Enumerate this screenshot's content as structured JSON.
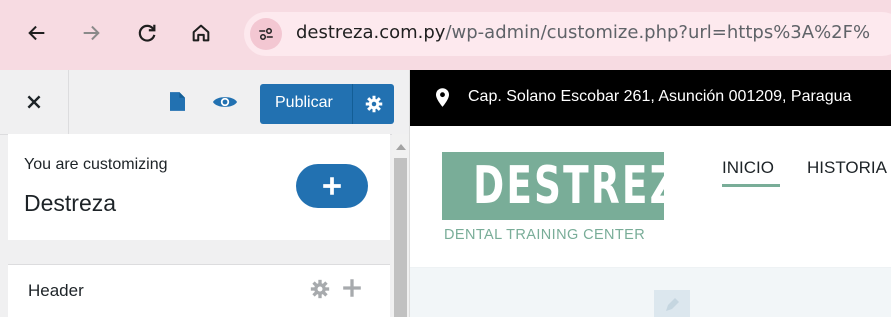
{
  "browser": {
    "url_domain": "destreza.com.py",
    "url_path": "/wp-admin/customize.php?url=https%3A%2F%"
  },
  "customizer": {
    "close_icon": "close-icon",
    "publish_label": "Publicar",
    "info_label": "You are customizing",
    "site_title": "Destreza",
    "section_header_label": "Header",
    "accent_color": "#2271b1"
  },
  "preview": {
    "address": "Cap. Solano Escobar 261, Asunción 001209, Paragua",
    "logo_text": "DESTREZA",
    "logo_tagline": "DENTAL TRAINING CENTER",
    "menu": [
      "INICIO",
      "HISTORIA"
    ],
    "brand_color": "#79ad98"
  }
}
